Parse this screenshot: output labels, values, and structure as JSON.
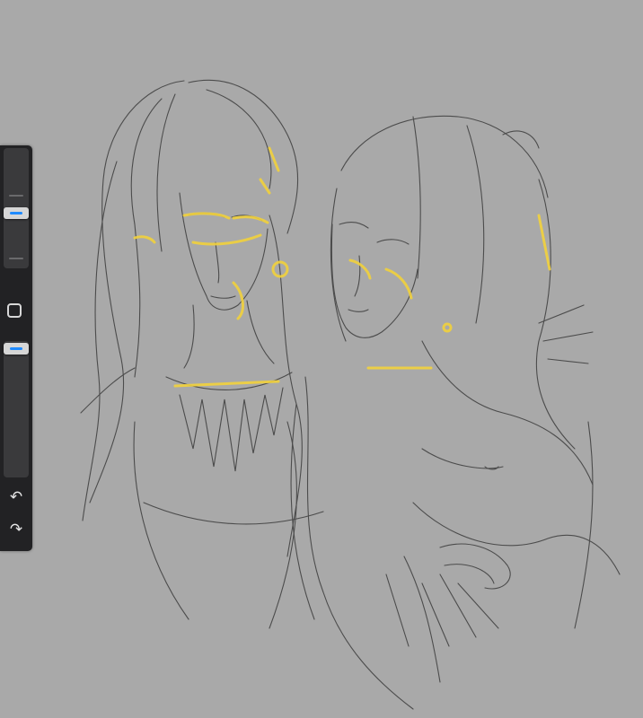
{
  "app": {
    "canvas": {
      "background": "#a9a9a9",
      "highlight_color": "#f2d23c",
      "line_color": "#3a3a3a"
    },
    "toolbar": {
      "background": "#222224",
      "accent": "#1f8bff",
      "brush_size": {
        "level": 0.45
      },
      "modify_button": {
        "icon": "square-icon"
      },
      "brush_opacity": {
        "level": 0.0
      },
      "undo": {
        "icon": "undo-arrow-icon"
      },
      "redo": {
        "icon": "redo-arrow-icon"
      }
    }
  }
}
